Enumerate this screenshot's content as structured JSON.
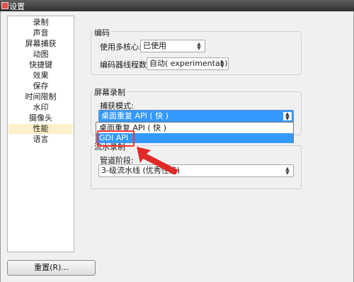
{
  "window": {
    "title": "设置"
  },
  "sidebar": {
    "items": [
      {
        "label": "录制",
        "selected": false
      },
      {
        "label": "声音",
        "selected": false
      },
      {
        "label": "屏幕捕获",
        "selected": false
      },
      {
        "label": "动图",
        "selected": false
      },
      {
        "label": "快捷键",
        "selected": false
      },
      {
        "label": "效果",
        "selected": false
      },
      {
        "label": "保存",
        "selected": false
      },
      {
        "label": "时间限制",
        "selected": false
      },
      {
        "label": "水印",
        "selected": false
      },
      {
        "label": "摄像头",
        "selected": false
      },
      {
        "label": "性能",
        "selected": true
      },
      {
        "label": "语言",
        "selected": false
      }
    ]
  },
  "encoding": {
    "title": "编码",
    "multicore_label": "使用多核心:",
    "multicore_value": "已使用",
    "threads_label": "编码器线程数:",
    "threads_value": "自动( experimental )"
  },
  "screen_record": {
    "title": "屏幕录制",
    "capture_mode_label": "捕获模式:",
    "capture_mode_value": "桌面重复 API ( 快 )",
    "options": [
      "桌面重复 API ( 快 )",
      "GDI API"
    ]
  },
  "pipeline": {
    "title": "流水录制",
    "stage_label": "管道阶段:",
    "stage_value": "3-级流水线 (优秀性能)"
  },
  "footer": {
    "reset_label": "重置(R)..."
  },
  "colors": {
    "highlight": "#ff3333",
    "selection": "#3399ff",
    "sidebar_selected": "#fbf0c9"
  }
}
